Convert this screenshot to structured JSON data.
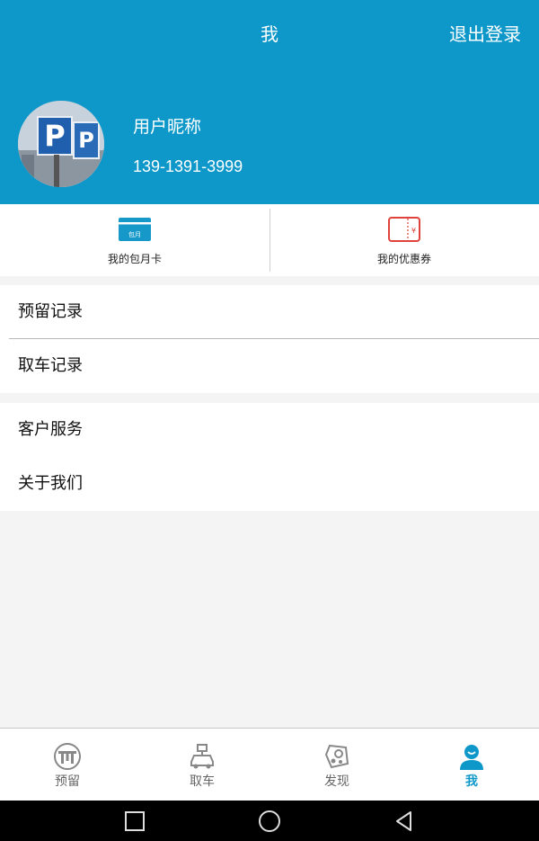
{
  "header": {
    "title": "我",
    "logout_label": "退出登录",
    "background_color": "#0e98c9"
  },
  "profile": {
    "nickname": "用户昵称",
    "phone": "139-1391-3999",
    "avatar_icon": "parking-sign-photo",
    "avatar_text": "P"
  },
  "cards": [
    {
      "label": "我的包月卡",
      "icon": "monthly-card-icon",
      "icon_text": "包月"
    },
    {
      "label": "我的优惠券",
      "icon": "coupon-icon",
      "icon_text": "¥"
    }
  ],
  "menu": {
    "group1": [
      {
        "label": "预留记录"
      },
      {
        "label": "取车记录"
      }
    ],
    "group2": [
      {
        "label": "客户服务"
      },
      {
        "label": "关于我们"
      }
    ]
  },
  "tabbar": {
    "items": [
      {
        "label": "预留",
        "icon": "reserve-icon",
        "active": false
      },
      {
        "label": "取车",
        "icon": "car-pickup-icon",
        "active": false
      },
      {
        "label": "发现",
        "icon": "discover-icon",
        "active": false
      },
      {
        "label": "我",
        "icon": "user-icon",
        "active": true
      }
    ],
    "active_color": "#0e98c9"
  },
  "system_nav": [
    "square-icon",
    "circle-icon",
    "back-triangle-icon"
  ]
}
